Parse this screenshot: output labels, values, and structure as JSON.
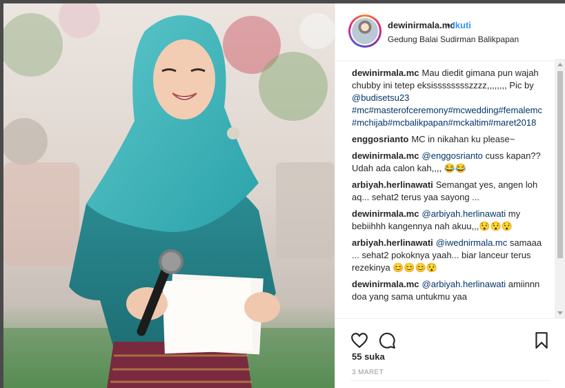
{
  "post": {
    "username": "dewinirmala.mc",
    "follow_separator": "•",
    "follow_label": "Ikuti",
    "location": "Gedung Balai Sudirman Balikpapan"
  },
  "comments": [
    {
      "user": "dewinirmala.mc",
      "parts": [
        {
          "t": "Mau diedit gimana pun wajah chubby ini tetep eksisssssssszzzz,,,,,,,, Pic by "
        },
        {
          "t": "@budisetsu23",
          "link": true
        },
        {
          "t": " "
        },
        {
          "t": "#mc#masterofceremony#mcwedding#femalemc#mchijab#mcbalikpapan#mckaltim#maret2018",
          "link": true
        }
      ]
    },
    {
      "user": "enggosrianto",
      "parts": [
        {
          "t": "MC in nikahan ku please~"
        }
      ]
    },
    {
      "user": "dewinirmala.mc",
      "parts": [
        {
          "t": "@enggosrianto",
          "link": true
        },
        {
          "t": " cuss kapan?? Udah ada calon kah,,,, 😂😂"
        }
      ]
    },
    {
      "user": "arbiyah.herlinawati",
      "parts": [
        {
          "t": "Semangat yes, angen loh aq... sehat2 terus yaa sayong ..."
        }
      ]
    },
    {
      "user": "dewinirmala.mc",
      "parts": [
        {
          "t": "@arbiyah.herlinawati",
          "link": true
        },
        {
          "t": " my bebiihhh kangennya nah akuu,,,😯😯😯"
        }
      ]
    },
    {
      "user": "arbiyah.herlinawati",
      "parts": [
        {
          "t": "@iwednirmala.mc",
          "link": true
        },
        {
          "t": " samaaa ... sehat2 pokoknya yaah... biar lanceur terus rezekinya 😊😊😊😯"
        }
      ]
    },
    {
      "user": "dewinirmala.mc",
      "parts": [
        {
          "t": "@arbiyah.herlinawati",
          "link": true
        },
        {
          "t": " amiinnn doa yang sama untukmu yaa"
        }
      ]
    }
  ],
  "actions": {
    "like_icon": "heart-icon",
    "comment_icon": "comment-bubble-icon",
    "save_icon": "bookmark-icon"
  },
  "likes_text": "55 suka",
  "date_text": "3 MARET",
  "colors": {
    "link": "#003569",
    "follow": "#3897f0",
    "text": "#262626",
    "muted": "#999999"
  }
}
